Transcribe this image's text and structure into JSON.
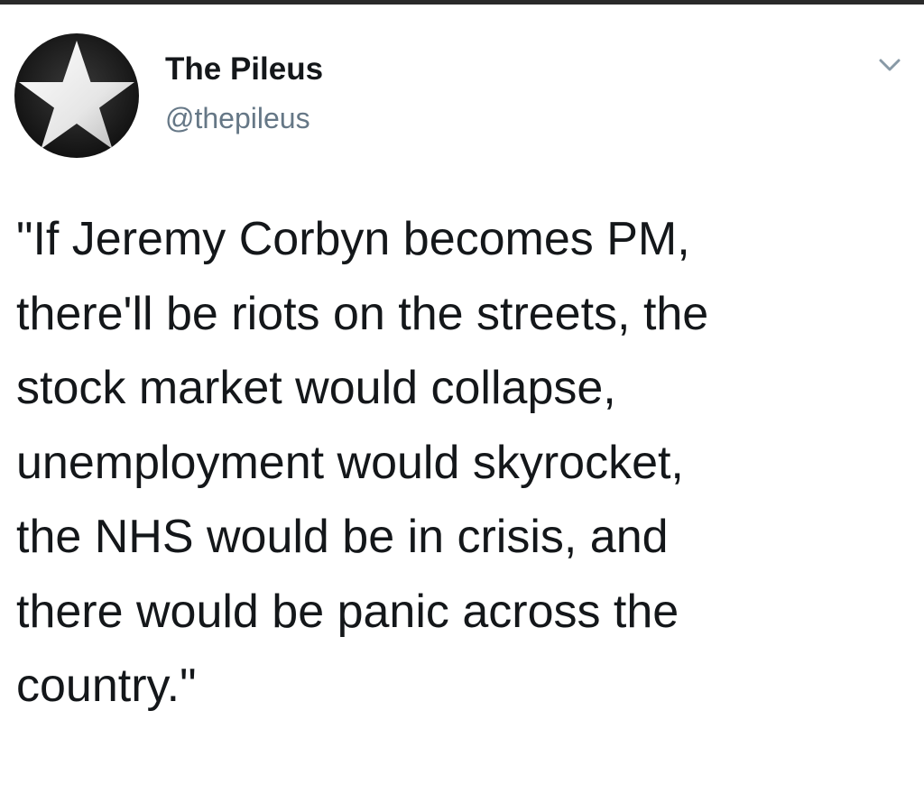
{
  "author": {
    "display_name": "The Pileus",
    "handle": "@thepileus",
    "avatar_icon": "star-icon"
  },
  "menu": {
    "icon": "chevron-down-icon"
  },
  "tweet": {
    "lines": [
      "\"If Jeremy Corbyn becomes PM,",
      "there'll be riots on the streets, the",
      "stock market would collapse,",
      "unemployment would skyrocket,",
      "the NHS would be in crisis, and",
      "there would be panic across the",
      "country.\""
    ]
  },
  "colors": {
    "name": "#14171a",
    "handle": "#657786",
    "text": "#14171a",
    "top_border": "#2a2a2a"
  }
}
